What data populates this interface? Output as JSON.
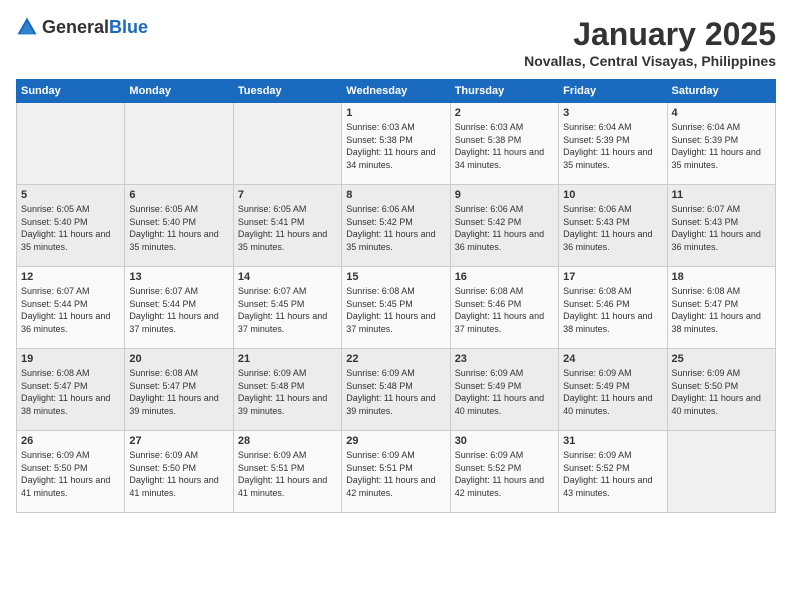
{
  "header": {
    "logo_general": "General",
    "logo_blue": "Blue",
    "month": "January 2025",
    "location": "Novallas, Central Visayas, Philippines"
  },
  "weekdays": [
    "Sunday",
    "Monday",
    "Tuesday",
    "Wednesday",
    "Thursday",
    "Friday",
    "Saturday"
  ],
  "weeks": [
    [
      {
        "day": "",
        "sunrise": "",
        "sunset": "",
        "daylight": ""
      },
      {
        "day": "",
        "sunrise": "",
        "sunset": "",
        "daylight": ""
      },
      {
        "day": "",
        "sunrise": "",
        "sunset": "",
        "daylight": ""
      },
      {
        "day": "1",
        "sunrise": "Sunrise: 6:03 AM",
        "sunset": "Sunset: 5:38 PM",
        "daylight": "Daylight: 11 hours and 34 minutes."
      },
      {
        "day": "2",
        "sunrise": "Sunrise: 6:03 AM",
        "sunset": "Sunset: 5:38 PM",
        "daylight": "Daylight: 11 hours and 34 minutes."
      },
      {
        "day": "3",
        "sunrise": "Sunrise: 6:04 AM",
        "sunset": "Sunset: 5:39 PM",
        "daylight": "Daylight: 11 hours and 35 minutes."
      },
      {
        "day": "4",
        "sunrise": "Sunrise: 6:04 AM",
        "sunset": "Sunset: 5:39 PM",
        "daylight": "Daylight: 11 hours and 35 minutes."
      }
    ],
    [
      {
        "day": "5",
        "sunrise": "Sunrise: 6:05 AM",
        "sunset": "Sunset: 5:40 PM",
        "daylight": "Daylight: 11 hours and 35 minutes."
      },
      {
        "day": "6",
        "sunrise": "Sunrise: 6:05 AM",
        "sunset": "Sunset: 5:40 PM",
        "daylight": "Daylight: 11 hours and 35 minutes."
      },
      {
        "day": "7",
        "sunrise": "Sunrise: 6:05 AM",
        "sunset": "Sunset: 5:41 PM",
        "daylight": "Daylight: 11 hours and 35 minutes."
      },
      {
        "day": "8",
        "sunrise": "Sunrise: 6:06 AM",
        "sunset": "Sunset: 5:42 PM",
        "daylight": "Daylight: 11 hours and 35 minutes."
      },
      {
        "day": "9",
        "sunrise": "Sunrise: 6:06 AM",
        "sunset": "Sunset: 5:42 PM",
        "daylight": "Daylight: 11 hours and 36 minutes."
      },
      {
        "day": "10",
        "sunrise": "Sunrise: 6:06 AM",
        "sunset": "Sunset: 5:43 PM",
        "daylight": "Daylight: 11 hours and 36 minutes."
      },
      {
        "day": "11",
        "sunrise": "Sunrise: 6:07 AM",
        "sunset": "Sunset: 5:43 PM",
        "daylight": "Daylight: 11 hours and 36 minutes."
      }
    ],
    [
      {
        "day": "12",
        "sunrise": "Sunrise: 6:07 AM",
        "sunset": "Sunset: 5:44 PM",
        "daylight": "Daylight: 11 hours and 36 minutes."
      },
      {
        "day": "13",
        "sunrise": "Sunrise: 6:07 AM",
        "sunset": "Sunset: 5:44 PM",
        "daylight": "Daylight: 11 hours and 37 minutes."
      },
      {
        "day": "14",
        "sunrise": "Sunrise: 6:07 AM",
        "sunset": "Sunset: 5:45 PM",
        "daylight": "Daylight: 11 hours and 37 minutes."
      },
      {
        "day": "15",
        "sunrise": "Sunrise: 6:08 AM",
        "sunset": "Sunset: 5:45 PM",
        "daylight": "Daylight: 11 hours and 37 minutes."
      },
      {
        "day": "16",
        "sunrise": "Sunrise: 6:08 AM",
        "sunset": "Sunset: 5:46 PM",
        "daylight": "Daylight: 11 hours and 37 minutes."
      },
      {
        "day": "17",
        "sunrise": "Sunrise: 6:08 AM",
        "sunset": "Sunset: 5:46 PM",
        "daylight": "Daylight: 11 hours and 38 minutes."
      },
      {
        "day": "18",
        "sunrise": "Sunrise: 6:08 AM",
        "sunset": "Sunset: 5:47 PM",
        "daylight": "Daylight: 11 hours and 38 minutes."
      }
    ],
    [
      {
        "day": "19",
        "sunrise": "Sunrise: 6:08 AM",
        "sunset": "Sunset: 5:47 PM",
        "daylight": "Daylight: 11 hours and 38 minutes."
      },
      {
        "day": "20",
        "sunrise": "Sunrise: 6:08 AM",
        "sunset": "Sunset: 5:47 PM",
        "daylight": "Daylight: 11 hours and 39 minutes."
      },
      {
        "day": "21",
        "sunrise": "Sunrise: 6:09 AM",
        "sunset": "Sunset: 5:48 PM",
        "daylight": "Daylight: 11 hours and 39 minutes."
      },
      {
        "day": "22",
        "sunrise": "Sunrise: 6:09 AM",
        "sunset": "Sunset: 5:48 PM",
        "daylight": "Daylight: 11 hours and 39 minutes."
      },
      {
        "day": "23",
        "sunrise": "Sunrise: 6:09 AM",
        "sunset": "Sunset: 5:49 PM",
        "daylight": "Daylight: 11 hours and 40 minutes."
      },
      {
        "day": "24",
        "sunrise": "Sunrise: 6:09 AM",
        "sunset": "Sunset: 5:49 PM",
        "daylight": "Daylight: 11 hours and 40 minutes."
      },
      {
        "day": "25",
        "sunrise": "Sunrise: 6:09 AM",
        "sunset": "Sunset: 5:50 PM",
        "daylight": "Daylight: 11 hours and 40 minutes."
      }
    ],
    [
      {
        "day": "26",
        "sunrise": "Sunrise: 6:09 AM",
        "sunset": "Sunset: 5:50 PM",
        "daylight": "Daylight: 11 hours and 41 minutes."
      },
      {
        "day": "27",
        "sunrise": "Sunrise: 6:09 AM",
        "sunset": "Sunset: 5:50 PM",
        "daylight": "Daylight: 11 hours and 41 minutes."
      },
      {
        "day": "28",
        "sunrise": "Sunrise: 6:09 AM",
        "sunset": "Sunset: 5:51 PM",
        "daylight": "Daylight: 11 hours and 41 minutes."
      },
      {
        "day": "29",
        "sunrise": "Sunrise: 6:09 AM",
        "sunset": "Sunset: 5:51 PM",
        "daylight": "Daylight: 11 hours and 42 minutes."
      },
      {
        "day": "30",
        "sunrise": "Sunrise: 6:09 AM",
        "sunset": "Sunset: 5:52 PM",
        "daylight": "Daylight: 11 hours and 42 minutes."
      },
      {
        "day": "31",
        "sunrise": "Sunrise: 6:09 AM",
        "sunset": "Sunset: 5:52 PM",
        "daylight": "Daylight: 11 hours and 43 minutes."
      },
      {
        "day": "",
        "sunrise": "",
        "sunset": "",
        "daylight": ""
      }
    ]
  ]
}
